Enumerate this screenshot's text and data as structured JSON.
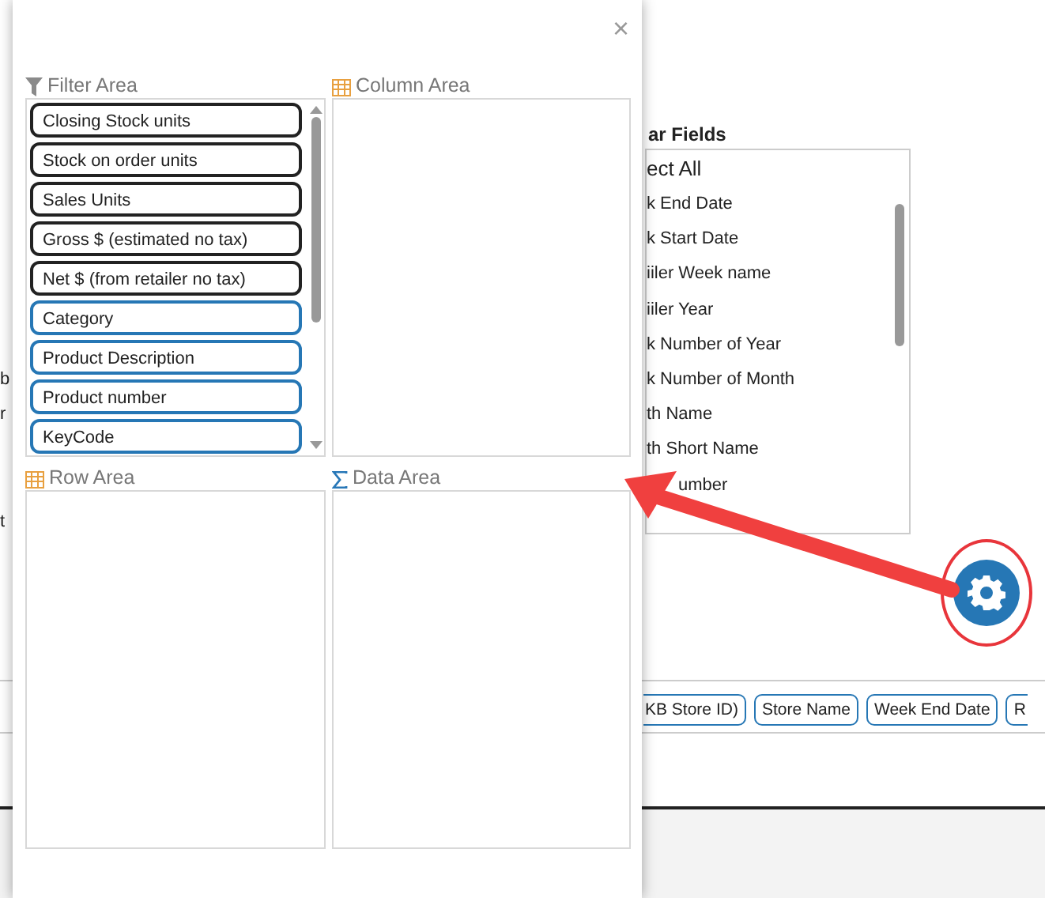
{
  "background": {
    "left_fragments": [
      "b",
      "r",
      "t"
    ],
    "fields_panel": {
      "title": "ar Fields",
      "select_all": "ect All",
      "items": [
        "k End Date",
        "k Start Date",
        "iiler Week name",
        "iiler Year",
        "k Number of Year",
        "k Number of Month",
        "th Name",
        "th Short Name",
        "umber"
      ]
    },
    "pills": [
      "KB Store ID)",
      "Store Name",
      "Week End Date",
      "R"
    ]
  },
  "dialog": {
    "close": "×",
    "filter_area": {
      "title": "Filter Area",
      "fields": [
        {
          "label": "Closing Stock units",
          "kind": "measure"
        },
        {
          "label": "Stock on order units",
          "kind": "measure"
        },
        {
          "label": "Sales Units",
          "kind": "measure"
        },
        {
          "label": "Gross $ (estimated no tax)",
          "kind": "measure"
        },
        {
          "label": "Net $ (from retailer no tax)",
          "kind": "measure"
        },
        {
          "label": "Category",
          "kind": "dimension"
        },
        {
          "label": "Product Description",
          "kind": "dimension"
        },
        {
          "label": "Product number",
          "kind": "dimension"
        },
        {
          "label": "KeyCode",
          "kind": "dimension"
        }
      ]
    },
    "column_area": {
      "title": "Column Area"
    },
    "row_area": {
      "title": "Row Area"
    },
    "data_area": {
      "title": "Data Area"
    }
  }
}
